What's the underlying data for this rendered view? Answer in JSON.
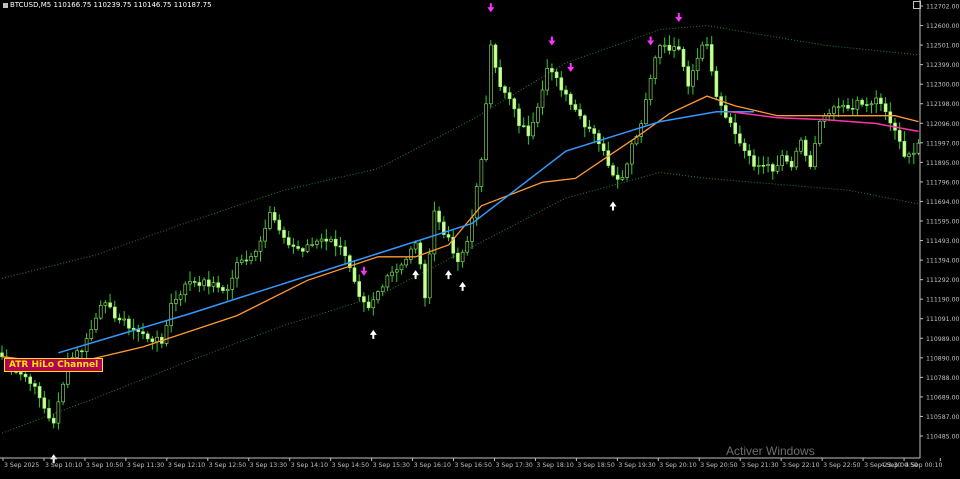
{
  "window": {
    "symbol_timeframe": "BTCUSD,M5",
    "ohlc": "110166.75 110239.75 110146.75 110187.75"
  },
  "indicator": {
    "label": "ATR HiLo Channel"
  },
  "os_watermark": "Activer Windows",
  "colors": {
    "background": "#000000",
    "axis": "#c0c0c0",
    "candle_bull_body": "#000000",
    "candle_bear_body": "#ccff99",
    "candle_outline": "#99ee66",
    "wick": "#33cc33",
    "channel_dots": "#2e7d32",
    "ma_blue": "#3399ff",
    "ma_orange": "#ff9933",
    "ma_magenta": "#ff33aa",
    "signal_up": "#ffffff",
    "signal_down": "#ff33ff"
  },
  "chart_data": {
    "type": "candlestick",
    "ylim": [
      110485,
      112710
    ],
    "y_ticks": [
      "112702.00",
      "112600.00",
      "112501.00",
      "112399.00",
      "112300.00",
      "112198.00",
      "112096.00",
      "111997.00",
      "111895.00",
      "111796.00",
      "111694.00",
      "111595.00",
      "111493.00",
      "111394.00",
      "111292.00",
      "111190.00",
      "111091.00",
      "110989.00",
      "110890.00",
      "110788.00",
      "110689.00",
      "110587.00",
      "110485.00"
    ],
    "x_ticks": [
      "3 Sep 2025",
      "3 Sep 10:10",
      "3 Sep 10:50",
      "3 Sep 11:30",
      "3 Sep 12:10",
      "3 Sep 12:50",
      "3 Sep 13:30",
      "3 Sep 14:10",
      "3 Sep 14:50",
      "3 Sep 15:30",
      "3 Sep 16:10",
      "3 Sep 16:50",
      "3 Sep 17:30",
      "3 Sep 18:10",
      "3 Sep 18:50",
      "3 Sep 19:30",
      "3 Sep 20:10",
      "3 Sep 20:50",
      "3 Sep 21:30",
      "3 Sep 22:10",
      "3 Sep 22:50",
      "3 Sep 23:30",
      "4 Sep 00:10",
      "4 Sep 00:50"
    ],
    "anchors": [
      [
        0,
        110910
      ],
      [
        3,
        110840
      ],
      [
        6,
        110790
      ],
      [
        9,
        110650
      ],
      [
        11,
        110560
      ],
      [
        14,
        110900
      ],
      [
        17,
        110950
      ],
      [
        19,
        111050
      ],
      [
        21,
        111190
      ],
      [
        25,
        111100
      ],
      [
        30,
        111020
      ],
      [
        34,
        110980
      ],
      [
        36,
        111180
      ],
      [
        40,
        111300
      ],
      [
        44,
        111280
      ],
      [
        48,
        111250
      ],
      [
        50,
        111380
      ],
      [
        54,
        111450
      ],
      [
        57,
        111650
      ],
      [
        60,
        111500
      ],
      [
        64,
        111450
      ],
      [
        68,
        111520
      ],
      [
        72,
        111480
      ],
      [
        74,
        111350
      ],
      [
        76,
        111200
      ],
      [
        78,
        111150
      ],
      [
        82,
        111330
      ],
      [
        86,
        111400
      ],
      [
        88,
        111500
      ],
      [
        90,
        111230
      ],
      [
        92,
        111650
      ],
      [
        95,
        111500
      ],
      [
        97,
        111380
      ],
      [
        99,
        111500
      ],
      [
        102,
        111900
      ],
      [
        104,
        112520
      ],
      [
        106,
        112280
      ],
      [
        108,
        112220
      ],
      [
        110,
        112100
      ],
      [
        112,
        112050
      ],
      [
        114,
        112200
      ],
      [
        116,
        112380
      ],
      [
        118,
        112320
      ],
      [
        120,
        112250
      ],
      [
        122,
        112180
      ],
      [
        124,
        112100
      ],
      [
        126,
        112060
      ],
      [
        128,
        111950
      ],
      [
        130,
        111850
      ],
      [
        132,
        111820
      ],
      [
        134,
        112000
      ],
      [
        136,
        112100
      ],
      [
        138,
        112350
      ],
      [
        140,
        112500
      ],
      [
        142,
        112480
      ],
      [
        144,
        112470
      ],
      [
        146,
        112300
      ],
      [
        148,
        112450
      ],
      [
        150,
        112520
      ],
      [
        152,
        112250
      ],
      [
        154,
        112150
      ],
      [
        156,
        112050
      ],
      [
        158,
        111960
      ],
      [
        160,
        111880
      ],
      [
        162,
        111900
      ],
      [
        164,
        111850
      ],
      [
        166,
        111920
      ],
      [
        168,
        111880
      ],
      [
        170,
        112000
      ],
      [
        172,
        111880
      ],
      [
        174,
        112100
      ],
      [
        176,
        112150
      ],
      [
        178,
        112180
      ],
      [
        180,
        112180
      ],
      [
        182,
        112200
      ],
      [
        184,
        112190
      ],
      [
        186,
        112220
      ],
      [
        188,
        112160
      ],
      [
        190,
        112050
      ],
      [
        192,
        111950
      ],
      [
        194,
        111950
      ],
      [
        195,
        111980
      ]
    ],
    "ma_blue": [
      [
        12,
        110930
      ],
      [
        40,
        111130
      ],
      [
        70,
        111360
      ],
      [
        100,
        111590
      ],
      [
        120,
        111960
      ],
      [
        140,
        112110
      ],
      [
        152,
        112160
      ],
      [
        160,
        112160
      ]
    ],
    "ma_orange": [
      [
        0,
        110910
      ],
      [
        14,
        110870
      ],
      [
        30,
        110960
      ],
      [
        50,
        111120
      ],
      [
        65,
        111300
      ],
      [
        80,
        111420
      ],
      [
        88,
        111420
      ],
      [
        95,
        111480
      ],
      [
        102,
        111680
      ],
      [
        115,
        111800
      ],
      [
        122,
        111820
      ],
      [
        130,
        111950
      ],
      [
        135,
        112030
      ],
      [
        142,
        112150
      ],
      [
        150,
        112240
      ],
      [
        156,
        112190
      ],
      [
        165,
        112140
      ],
      [
        180,
        112140
      ],
      [
        190,
        112140
      ],
      [
        195,
        112110
      ]
    ],
    "ma_magenta": [
      [
        155,
        112160
      ],
      [
        165,
        112130
      ],
      [
        175,
        112120
      ],
      [
        186,
        112100
      ],
      [
        195,
        112060
      ]
    ],
    "channel_upper": [
      [
        0,
        111310
      ],
      [
        20,
        111430
      ],
      [
        40,
        111600
      ],
      [
        60,
        111760
      ],
      [
        80,
        111870
      ],
      [
        100,
        112120
      ],
      [
        120,
        112410
      ],
      [
        140,
        112580
      ],
      [
        150,
        112600
      ],
      [
        160,
        112560
      ],
      [
        175,
        112500
      ],
      [
        195,
        112450
      ]
    ],
    "channel_lower": [
      [
        0,
        110520
      ],
      [
        20,
        110700
      ],
      [
        40,
        110890
      ],
      [
        60,
        111070
      ],
      [
        80,
        111220
      ],
      [
        100,
        111470
      ],
      [
        120,
        111720
      ],
      [
        140,
        111850
      ],
      [
        150,
        111820
      ],
      [
        165,
        111790
      ],
      [
        180,
        111760
      ],
      [
        195,
        111690
      ]
    ],
    "signals_up": [
      11,
      79,
      88,
      95,
      98,
      130
    ],
    "signals_down": [
      77,
      104,
      117,
      121,
      138,
      144
    ]
  }
}
